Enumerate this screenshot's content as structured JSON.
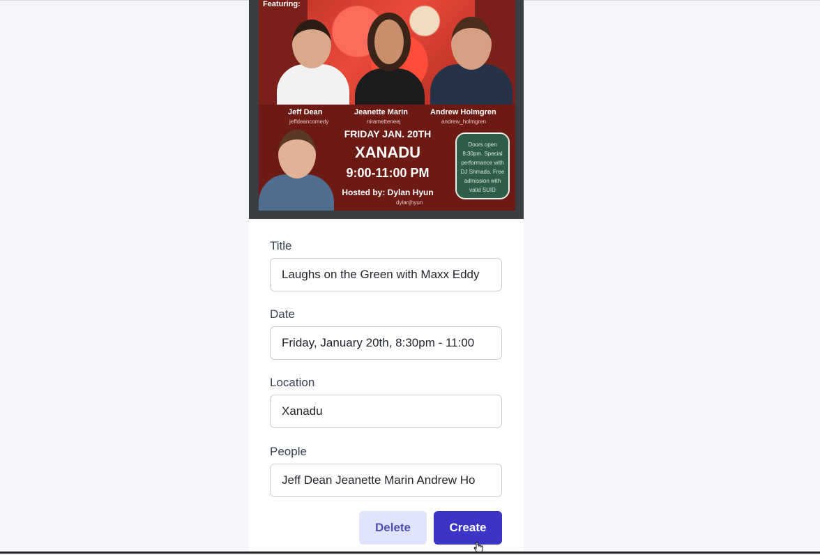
{
  "poster": {
    "featuring": "Featuring:",
    "performers": [
      {
        "name": "Jeff Dean",
        "handle": "jeffdeancomedy"
      },
      {
        "name": "Jeanette Marin",
        "handle": "nirametteneej"
      },
      {
        "name": "Andrew Holmgren",
        "handle": "andrew_holmgren"
      }
    ],
    "date_line": "FRIDAY JAN. 20TH",
    "venue": "XANADU",
    "time": "9:00-11:00 PM",
    "host_line": "Hosted by: Dylan Hyun",
    "host_handle": "dylanjhyun",
    "note": "Doors open 8:30pm. Special performance with DJ Shmada. Free admission with valid SUID"
  },
  "form": {
    "title": {
      "label": "Title",
      "value": "Laughs on the Green with Maxx Eddy"
    },
    "date": {
      "label": "Date",
      "value": "Friday, January 20th, 8:30pm - 11:00"
    },
    "location": {
      "label": "Location",
      "value": "Xanadu"
    },
    "people": {
      "label": "People",
      "value": "Jeff Dean Jeanette Marin Andrew Ho"
    }
  },
  "actions": {
    "delete_label": "Delete",
    "create_label": "Create"
  },
  "colors": {
    "primary": "#3a35c7",
    "secondary_bg": "#e0e4fb",
    "poster_red": "#7a1f1a",
    "note_green": "#2e5e47"
  }
}
